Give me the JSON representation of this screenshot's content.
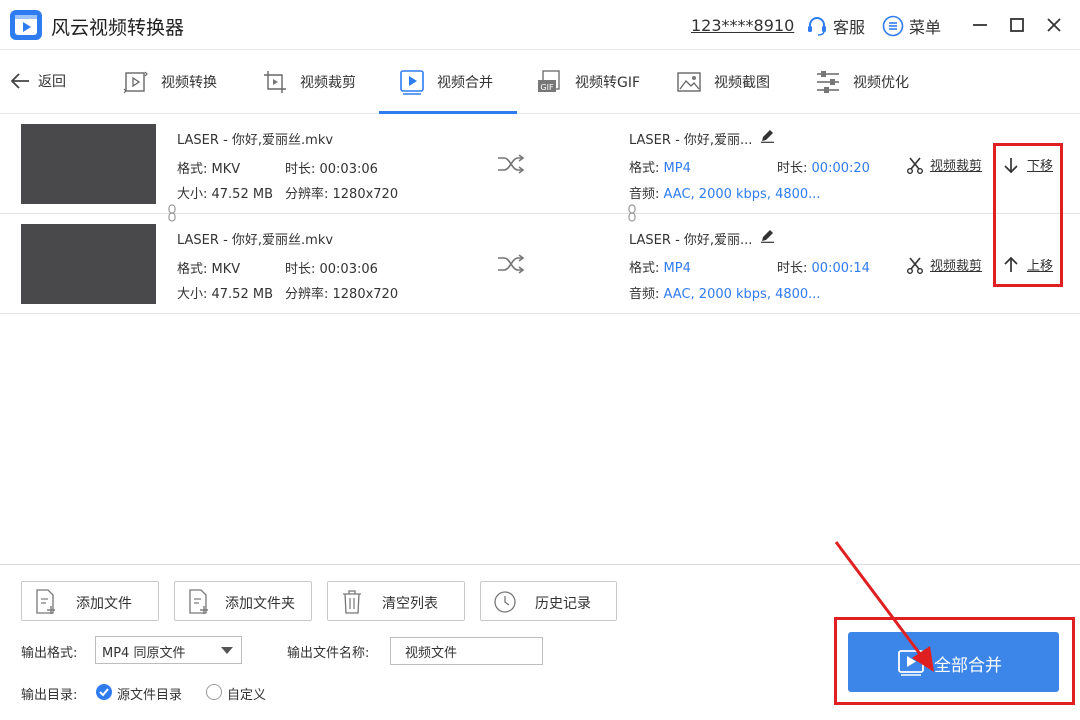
{
  "app": {
    "title": "风云视频转换器",
    "account": "123****8910",
    "support_label": "客服",
    "menu_label": "菜单",
    "icons": [
      "app-logo-icon",
      "headset-icon",
      "menu-list-icon",
      "minimize-icon",
      "maximize-icon",
      "close-icon"
    ]
  },
  "nav": {
    "back_label": "返回",
    "tabs": [
      {
        "label": "视频转换",
        "icon": "video-convert-icon"
      },
      {
        "label": "视频裁剪",
        "icon": "crop-icon"
      },
      {
        "label": "视频合并",
        "icon": "merge-play-icon",
        "active": true
      },
      {
        "label": "视频转GIF",
        "icon": "gif-icon"
      },
      {
        "label": "视频截图",
        "icon": "image-icon"
      },
      {
        "label": "视频优化",
        "icon": "sliders-icon"
      }
    ]
  },
  "files": [
    {
      "source_name": "LASER - 你好,爱丽丝.mkv",
      "format_label": "格式: MKV",
      "duration_label": "时长: 00:03:06",
      "size_label": "大小: 47.52 MB",
      "resolution_label": "分辨率: 1280x720",
      "output_name": "LASER - 你好,爱丽...",
      "out_format_key": "格式:",
      "out_format_val": "MP4",
      "out_duration_key": "时长:",
      "out_duration_val": "00:00:20",
      "audio_key": "音频:",
      "audio_val": "AAC, 2000 kbps, 4800...",
      "cut_label": "视频裁剪",
      "move_label": "下移"
    },
    {
      "source_name": "LASER - 你好,爱丽丝.mkv",
      "format_label": "格式: MKV",
      "duration_label": "时长: 00:03:06",
      "size_label": "大小: 47.52 MB",
      "resolution_label": "分辨率: 1280x720",
      "output_name": "LASER - 你好,爱丽...",
      "out_format_key": "格式:",
      "out_format_val": "MP4",
      "out_duration_key": "时长:",
      "out_duration_val": "00:00:14",
      "audio_key": "音频:",
      "audio_val": "AAC, 2000 kbps, 4800...",
      "cut_label": "视频裁剪",
      "move_label": "上移"
    }
  ],
  "actions": {
    "add_file": "添加文件",
    "add_folder": "添加文件夹",
    "clear_list": "清空列表",
    "history": "历史记录"
  },
  "output": {
    "format_label": "输出格式:",
    "format_value": "MP4 同原文件",
    "name_label": "输出文件名称:",
    "name_value": "视频文件",
    "dir_label": "输出目录:",
    "dir_option_source": "源文件目录",
    "dir_option_custom": "自定义",
    "dir_selected": "源文件目录"
  },
  "merge_all_label": "全部合并",
  "colors": {
    "accent": "#2f7cf0",
    "button": "#3d86e9",
    "highlight": "#e02020",
    "thumb": "#49494b"
  }
}
